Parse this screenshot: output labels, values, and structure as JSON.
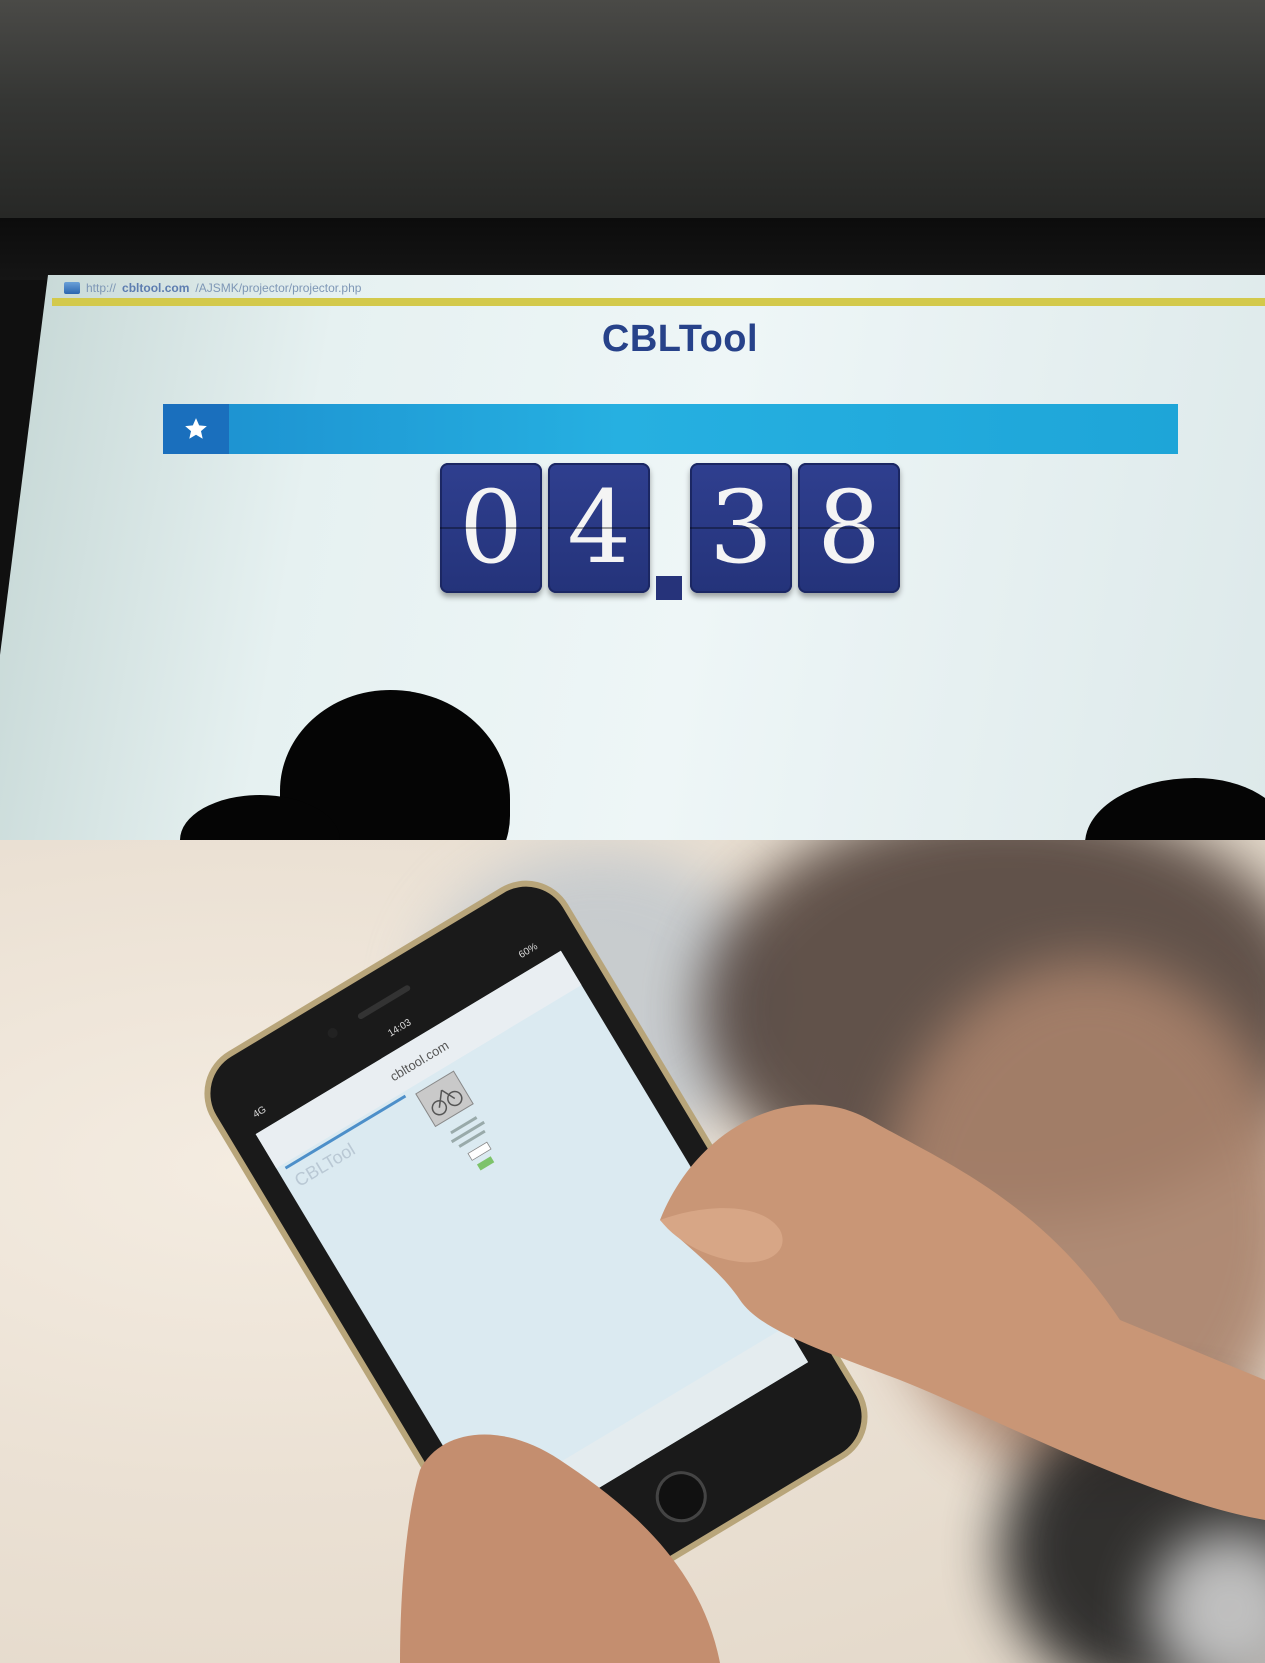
{
  "projector": {
    "url_prefix": "http://",
    "url_domain": "cbltool.com",
    "url_path": "/AJSMK/projector/projector.php",
    "app_title": "CBLTool",
    "star_icon": "star-icon",
    "timer": {
      "digits": [
        "0",
        "4",
        "3",
        "8"
      ],
      "minutes": "04",
      "seconds": "38"
    }
  },
  "phone": {
    "status_time": "14:03",
    "carrier": "4G",
    "battery": "60%",
    "address_bar": "cbltool.com",
    "app_logo_text": "CBLTool",
    "icon_semantic": "bicycle-icon"
  },
  "colors": {
    "title_blue": "#27428a",
    "bar_blue": "#26b0e1",
    "digit_card_blue": "#2f3f8f",
    "url_strip_yellow": "#d3c94b"
  }
}
